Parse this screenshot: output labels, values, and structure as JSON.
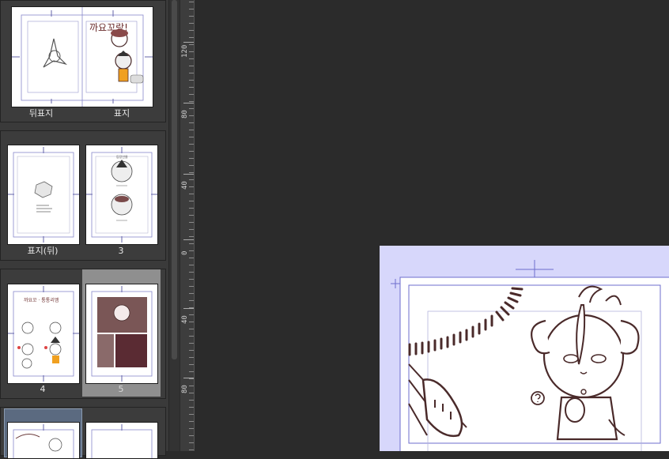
{
  "page_panel": {
    "spreads": [
      {
        "pages": [
          {
            "label": "뒤표지"
          },
          {
            "label": "표지"
          }
        ]
      },
      {
        "pages": [
          {
            "label": "표지(뒤)"
          },
          {
            "label": "3"
          }
        ]
      },
      {
        "pages": [
          {
            "label": "4"
          },
          {
            "label": "5"
          }
        ]
      },
      {
        "pages": [
          {
            "label": ""
          },
          {
            "label": ""
          }
        ]
      }
    ],
    "cover_title_text": "까요꼬랑!",
    "page4_title_text": "까요꼬 · 통통리엠",
    "page3_header_text": "등장인물"
  },
  "ruler": {
    "labels": [
      "120",
      "80",
      "40",
      "0",
      "40",
      "80"
    ]
  },
  "colors": {
    "canvas_bg": "#2b2b2b",
    "panel_bg": "#3a3a3a",
    "doc_bleed": "#d7d7fb",
    "guide": "#7777cc",
    "ink": "#4a2a2a"
  }
}
